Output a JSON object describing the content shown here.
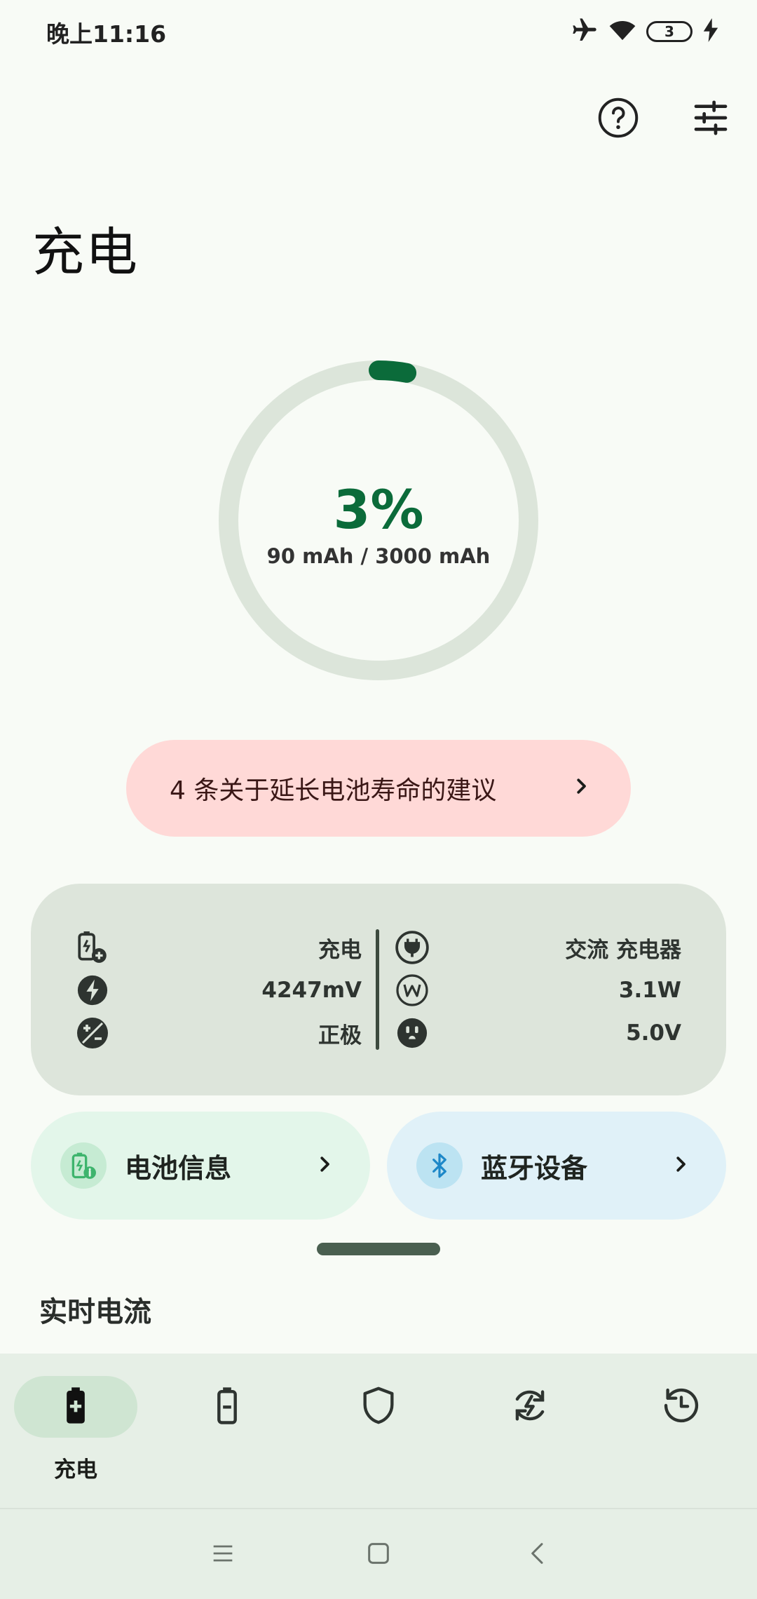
{
  "status_bar": {
    "time": "晚上11:16",
    "battery_level": "3",
    "icons": [
      "airplane-icon",
      "wifi-icon",
      "battery-icon",
      "charging-bolt-icon"
    ]
  },
  "header": {
    "title": "充电",
    "actions": [
      "help-icon",
      "tune-icon"
    ]
  },
  "charge": {
    "percent_text": "3%",
    "capacity_text": "90 mAh / 3000 mAh",
    "progress_fraction": 0.03,
    "accent_color": "#0B6B3A",
    "track_color": "#DCE5DA"
  },
  "tips": {
    "label": "4 条关于延长电池寿命的建议",
    "bg_color": "#FFD9D7"
  },
  "info_card": {
    "left": [
      {
        "icon": "battery-plus-icon",
        "value": "充电"
      },
      {
        "icon": "bolt-circle-icon",
        "value": "4247mV"
      },
      {
        "icon": "plus-minus-icon",
        "value": "正极"
      }
    ],
    "right": [
      {
        "icon": "plug-icon",
        "value": "交流 充电器"
      },
      {
        "icon": "watt-icon",
        "value": "3.1W"
      },
      {
        "icon": "outlet-icon",
        "value": "5.0V"
      }
    ]
  },
  "tiles": {
    "battery_info": {
      "label": "电池信息",
      "icon": "battery-info-icon"
    },
    "bluetooth": {
      "label": "蓝牙设备",
      "icon": "bluetooth-icon"
    }
  },
  "section": {
    "title": "实时电流"
  },
  "bottom_nav": {
    "items": [
      {
        "label": "充电",
        "icon": "battery-charging-icon",
        "active": true
      },
      {
        "icon": "battery-icon",
        "active": false
      },
      {
        "icon": "shield-icon",
        "active": false
      },
      {
        "icon": "sync-bolt-icon",
        "active": false
      },
      {
        "icon": "history-icon",
        "active": false
      }
    ]
  },
  "system_nav": [
    "menu-icon",
    "home-icon",
    "back-icon"
  ]
}
